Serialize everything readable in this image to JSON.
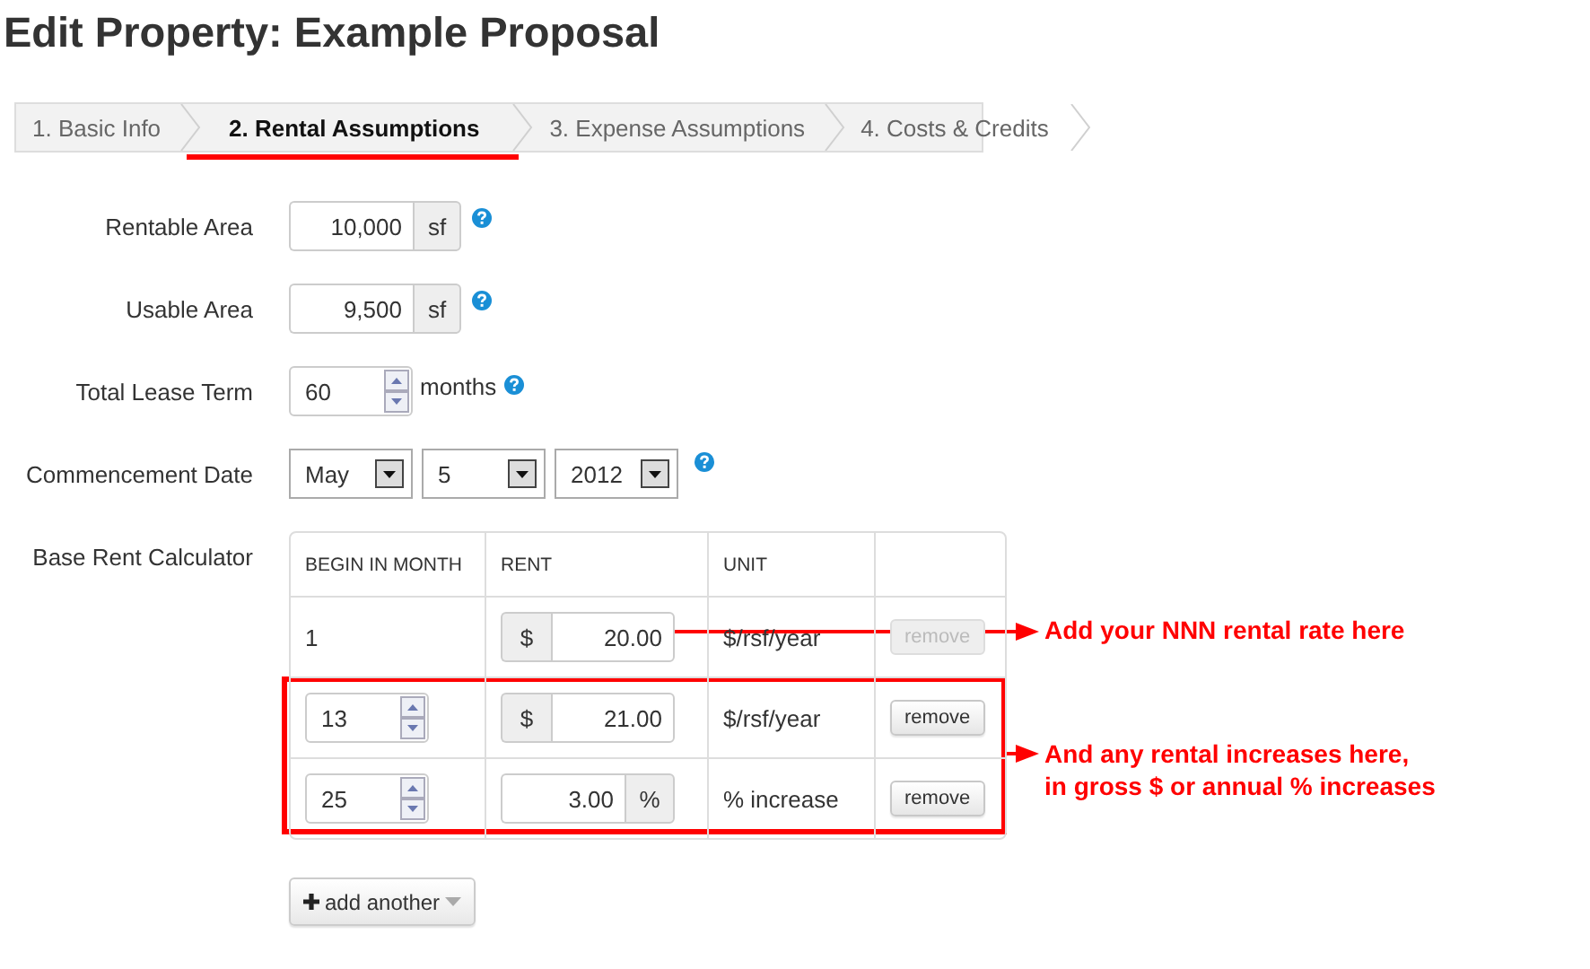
{
  "title": "Edit Property: Example Proposal",
  "steps": [
    {
      "label": "1. Basic Info",
      "selected": false
    },
    {
      "label": "2. Rental Assumptions",
      "selected": true
    },
    {
      "label": "3. Expense Assumptions",
      "selected": false
    },
    {
      "label": "4. Costs & Credits",
      "selected": false
    }
  ],
  "fields": [
    {
      "kind": "unit",
      "label": "Rentable Area",
      "value": "10,000",
      "unit": "sf"
    },
    {
      "kind": "unit",
      "label": "Usable Area",
      "value": "9,500",
      "unit": "sf"
    },
    {
      "kind": "spinner",
      "label": "Total Lease Term",
      "value": "60",
      "suffix": "months"
    },
    {
      "kind": "date",
      "label": "Commencement Date",
      "selects": [
        "May",
        "5",
        "2012"
      ]
    }
  ],
  "rent_calculator": {
    "label": "Base Rent Calculator",
    "columns": [
      "BEGIN IN MONTH",
      "RENT",
      "UNIT"
    ],
    "rows": [
      {
        "begin": {
          "kind": "text",
          "value": "1"
        },
        "rent": {
          "kind": "dollar",
          "symbol": "$",
          "value": "20.00"
        },
        "unit": "$/rsf/year",
        "remove": "remove",
        "remove_disabled": true
      },
      {
        "begin": {
          "kind": "spinner",
          "value": "13"
        },
        "rent": {
          "kind": "dollar",
          "symbol": "$",
          "value": "21.00"
        },
        "unit": "$/rsf/year",
        "remove": "remove",
        "remove_disabled": false
      },
      {
        "begin": {
          "kind": "spinner",
          "value": "25"
        },
        "rent": {
          "kind": "percent",
          "symbol": "%",
          "value": "3.00"
        },
        "unit": "% increase",
        "remove": "remove",
        "remove_disabled": false
      }
    ],
    "add_button": "add another"
  },
  "annotations": [
    {
      "kind": "arrow",
      "text": "Add your NNN rental rate here"
    },
    {
      "kind": "box_arrow",
      "text": "And any rental increases here,\nin gross $ or annual % increases"
    }
  ]
}
